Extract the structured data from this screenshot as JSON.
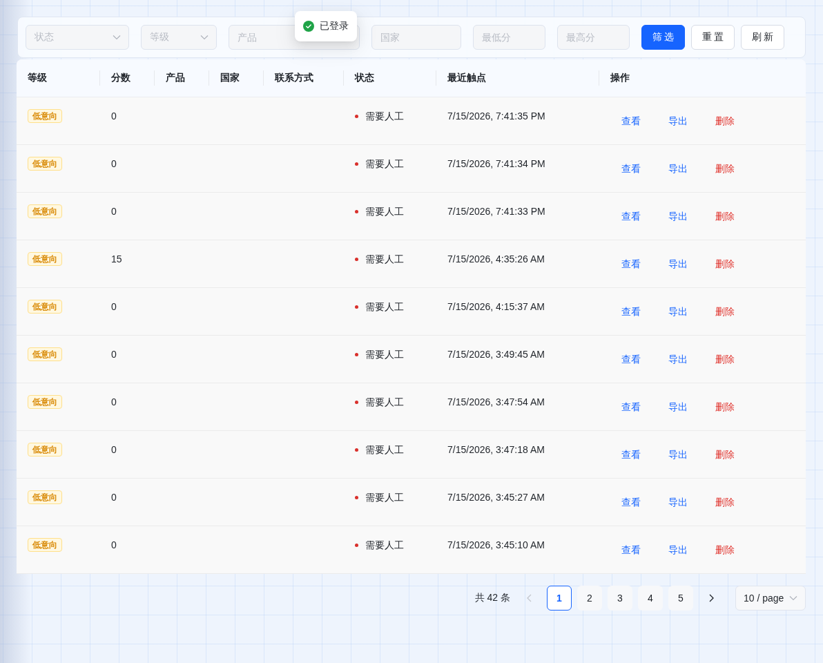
{
  "toast": {
    "text": "已登录"
  },
  "filters": [
    {
      "kind": "select",
      "placeholder": "状态"
    },
    {
      "kind": "select",
      "placeholder": "等级"
    },
    {
      "kind": "input",
      "placeholder": "产品"
    },
    {
      "kind": "input",
      "placeholder": "国家"
    },
    {
      "kind": "input",
      "placeholder": "最低分"
    },
    {
      "kind": "input",
      "placeholder": "最高分"
    }
  ],
  "buttons": [
    {
      "label": "筛 选",
      "kind": "primary"
    },
    {
      "label": "重 置",
      "kind": "default"
    },
    {
      "label": "刷 新",
      "kind": "default"
    }
  ],
  "table": {
    "columns": [
      "等级",
      "分数",
      "产品",
      "国家",
      "联系方式",
      "状态",
      "最近触点",
      "操作"
    ],
    "rows": [
      {
        "level": "低意向",
        "score": "0",
        "status": "需要人工",
        "last_touch": "7/15/2026, 7:41:35 PM",
        "actions": [
          {
            "label": "查看",
            "kind": "view"
          },
          {
            "label": "导出",
            "kind": "export"
          },
          {
            "label": "删除",
            "kind": "delete"
          }
        ]
      },
      {
        "level": "低意向",
        "score": "0",
        "status": "需要人工",
        "last_touch": "7/15/2026, 7:41:34 PM",
        "actions": [
          {
            "label": "查看",
            "kind": "view"
          },
          {
            "label": "导出",
            "kind": "export"
          },
          {
            "label": "删除",
            "kind": "delete"
          }
        ]
      },
      {
        "level": "低意向",
        "score": "0",
        "status": "需要人工",
        "last_touch": "7/15/2026, 7:41:33 PM",
        "actions": [
          {
            "label": "查看",
            "kind": "view"
          },
          {
            "label": "导出",
            "kind": "export"
          },
          {
            "label": "删除",
            "kind": "delete"
          }
        ]
      },
      {
        "level": "低意向",
        "score": "15",
        "status": "需要人工",
        "last_touch": "7/15/2026, 4:35:26 AM",
        "actions": [
          {
            "label": "查看",
            "kind": "view"
          },
          {
            "label": "导出",
            "kind": "export"
          },
          {
            "label": "删除",
            "kind": "delete"
          }
        ]
      },
      {
        "level": "低意向",
        "score": "0",
        "status": "需要人工",
        "last_touch": "7/15/2026, 4:15:37 AM",
        "actions": [
          {
            "label": "查看",
            "kind": "view"
          },
          {
            "label": "导出",
            "kind": "export"
          },
          {
            "label": "删除",
            "kind": "delete"
          }
        ]
      },
      {
        "level": "低意向",
        "score": "0",
        "status": "需要人工",
        "last_touch": "7/15/2026, 3:49:45 AM",
        "actions": [
          {
            "label": "查看",
            "kind": "view"
          },
          {
            "label": "导出",
            "kind": "export"
          },
          {
            "label": "删除",
            "kind": "delete"
          }
        ]
      },
      {
        "level": "低意向",
        "score": "0",
        "status": "需要人工",
        "last_touch": "7/15/2026, 3:47:54 AM",
        "actions": [
          {
            "label": "查看",
            "kind": "view"
          },
          {
            "label": "导出",
            "kind": "export"
          },
          {
            "label": "删除",
            "kind": "delete"
          }
        ]
      },
      {
        "level": "低意向",
        "score": "0",
        "status": "需要人工",
        "last_touch": "7/15/2026, 3:47:18 AM",
        "actions": [
          {
            "label": "查看",
            "kind": "view"
          },
          {
            "label": "导出",
            "kind": "export"
          },
          {
            "label": "删除",
            "kind": "delete"
          }
        ]
      },
      {
        "level": "低意向",
        "score": "0",
        "status": "需要人工",
        "last_touch": "7/15/2026, 3:45:27 AM",
        "actions": [
          {
            "label": "查看",
            "kind": "view"
          },
          {
            "label": "导出",
            "kind": "export"
          },
          {
            "label": "删除",
            "kind": "delete"
          }
        ]
      },
      {
        "level": "低意向",
        "score": "0",
        "status": "需要人工",
        "last_touch": "7/15/2026, 3:45:10 AM",
        "actions": [
          {
            "label": "查看",
            "kind": "view"
          },
          {
            "label": "导出",
            "kind": "export"
          },
          {
            "label": "删除",
            "kind": "delete"
          }
        ]
      }
    ]
  },
  "pagination": {
    "total": "共 42 条",
    "previous": {
      "disabled": true
    },
    "next": {
      "disabled": false
    },
    "pages": [
      {
        "label": "1",
        "selected": true
      },
      {
        "label": "2",
        "selected": false
      },
      {
        "label": "3",
        "selected": false
      },
      {
        "label": "4",
        "selected": false
      },
      {
        "label": "5",
        "selected": false
      }
    ],
    "page_size": "10 / page"
  }
}
